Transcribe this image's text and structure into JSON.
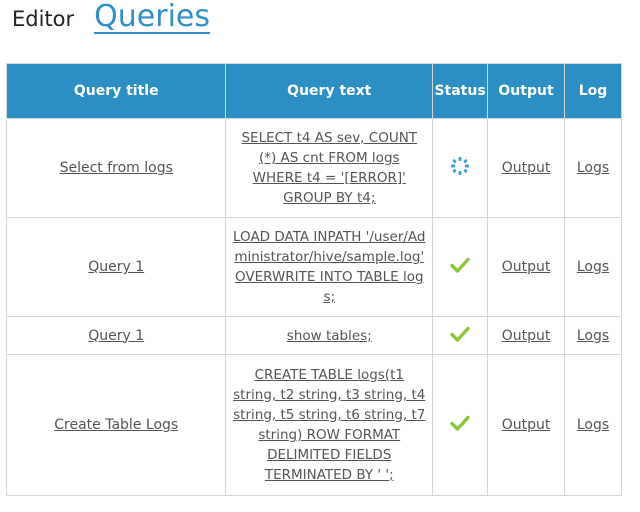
{
  "header": {
    "editor_label": "Editor",
    "queries_label": "Queries"
  },
  "table": {
    "columns": [
      "Query title",
      "Query text",
      "Status",
      "Output",
      "Log"
    ],
    "rows": [
      {
        "title": "Select from logs",
        "text": "SELECT t4 AS sev, COUNT (*) AS cnt FROM logs WHERE t4 = '[ERROR]' GROUP BY t4;",
        "status": "running",
        "output": "Output",
        "log": "Logs"
      },
      {
        "title": "Query 1",
        "text": "LOAD DATA INPATH '/user/Administrator/hive/sample.log' OVERWRITE INTO TABLE logs;",
        "status": "success",
        "output": "Output",
        "log": "Logs"
      },
      {
        "title": "Query 1",
        "text": "show tables;",
        "status": "success",
        "output": "Output",
        "log": "Logs"
      },
      {
        "title": "Create Table Logs",
        "text": "CREATE TABLE logs(t1 string, t2 string, t3 string, t4 string, t5 string, t6 string, t7 string) ROW FORMAT DELIMITED FIELDS TERMINATED BY ' ';",
        "status": "success",
        "output": "Output",
        "log": "Logs"
      }
    ]
  },
  "icons": {
    "running": "spinner-icon",
    "success": "checkmark-icon"
  },
  "colors": {
    "header_bg": "#2b8fc3",
    "accent": "#2f8fc9",
    "success": "#8cc63f",
    "spinner": "#3aa0d8"
  }
}
